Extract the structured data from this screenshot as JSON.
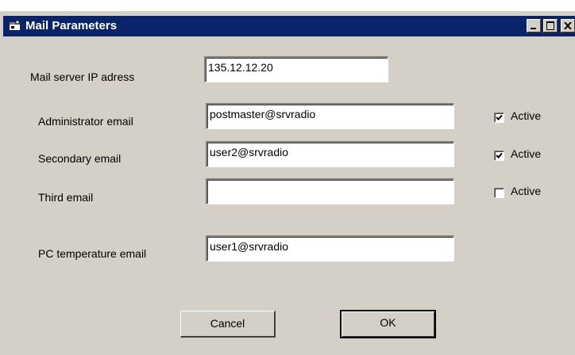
{
  "window": {
    "title": "Mail Parameters",
    "controls": {
      "minimize": "minimize",
      "maximize": "maximize",
      "close": "close"
    }
  },
  "form": {
    "server": {
      "label": "Mail server IP adress",
      "value": "135.12.12.20"
    },
    "admin": {
      "label": "Administrator email",
      "value": "postmaster@srvradio",
      "active_label": "Active",
      "active": true
    },
    "secondary": {
      "label": "Secondary email",
      "value": "user2@srvradio",
      "active_label": "Active",
      "active": true
    },
    "third": {
      "label": "Third email",
      "value": "",
      "active_label": "Active",
      "active": false
    },
    "pc_temp": {
      "label": "PC temperature email",
      "value": "user1@srvradio"
    }
  },
  "buttons": {
    "cancel": "Cancel",
    "ok": "OK"
  },
  "colors": {
    "titlebar": "#0a246a",
    "dialog_bg": "#d4d0c8",
    "field_bg": "#ffffff"
  }
}
